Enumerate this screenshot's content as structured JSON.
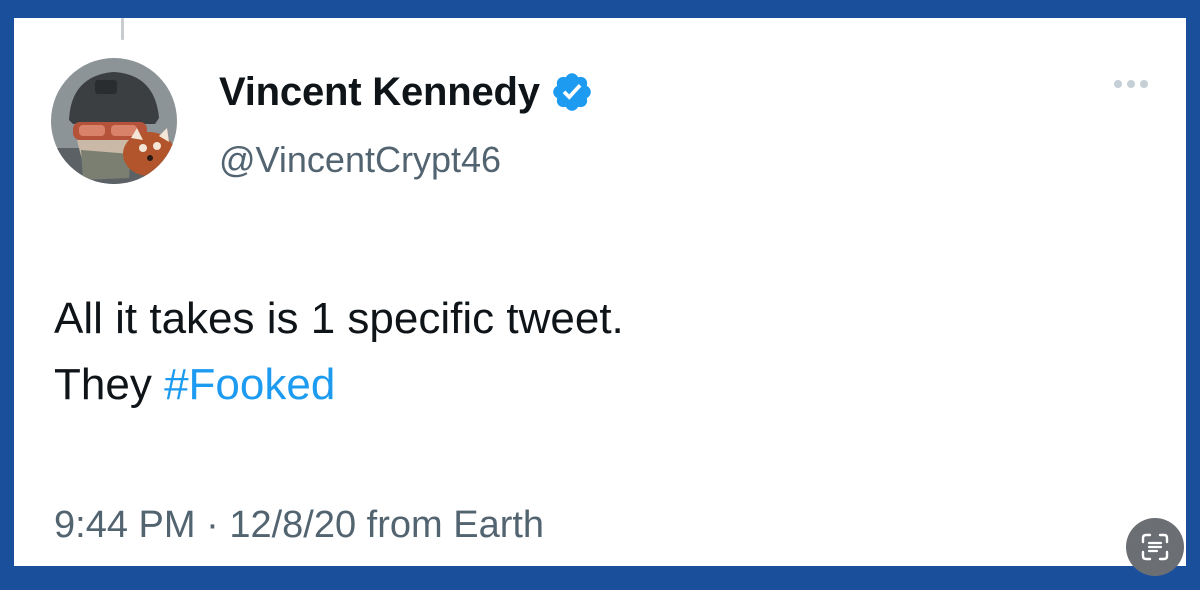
{
  "tweet": {
    "display_name": "Vincent Kennedy",
    "handle": "@VincentCrypt46",
    "verified": true,
    "text_line_1": "All it takes is 1 specific tweet.",
    "text_line_2_prefix": "They",
    "hashtag": "#Fooked",
    "time": "9:44 PM",
    "separator": "·",
    "date": "12/8/20",
    "source": "from Earth"
  },
  "icons": {
    "verified": "verified-badge-icon",
    "more": "more-options-icon",
    "scan": "live-text-scan-icon"
  },
  "colors": {
    "background_frame": "#1a4f9c",
    "hashtag": "#1d9bf0",
    "secondary_text": "#536471",
    "primary_text": "#0f1419"
  }
}
